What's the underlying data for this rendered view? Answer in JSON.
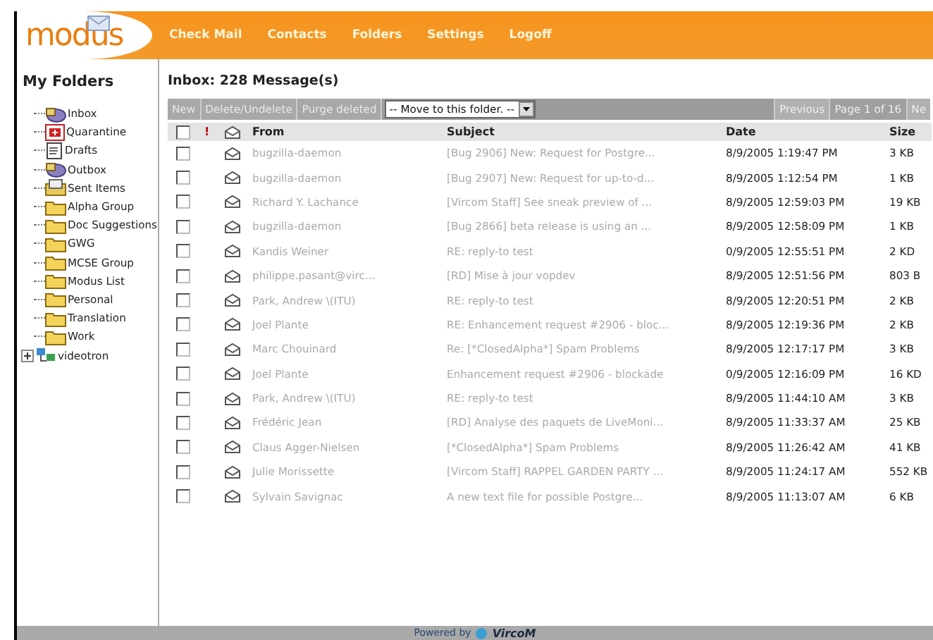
{
  "header": {
    "logo": "modus",
    "nav": [
      "Check Mail",
      "Contacts",
      "Folders",
      "Settings",
      "Logoff"
    ]
  },
  "sidebar": {
    "title": "My Folders",
    "items": [
      {
        "kind": "inbox",
        "label": "Inbox"
      },
      {
        "kind": "quarantine",
        "label": "Quarantine"
      },
      {
        "kind": "drafts",
        "label": "Drafts"
      },
      {
        "kind": "outbox",
        "label": "Outbox"
      },
      {
        "kind": "sent",
        "label": "Sent Items"
      },
      {
        "kind": "folder",
        "label": "Alpha Group"
      },
      {
        "kind": "folder",
        "label": "Doc Suggestions"
      },
      {
        "kind": "folder",
        "label": "GWG"
      },
      {
        "kind": "folder",
        "label": "MCSE Group"
      },
      {
        "kind": "folder",
        "label": "Modus List"
      },
      {
        "kind": "folder",
        "label": "Personal"
      },
      {
        "kind": "folder",
        "label": "Translation"
      },
      {
        "kind": "folder",
        "label": "Work"
      },
      {
        "kind": "account",
        "label": "videotron",
        "expanded": false
      }
    ]
  },
  "mailbox": {
    "title": "Inbox: 228 Message(s)",
    "toolbar": {
      "buttons": [
        "New",
        "Delete/Undelete",
        "Purge deleted"
      ],
      "move_select": "-- Move to this folder. --",
      "pager": [
        "Previous",
        "Page 1 of 16",
        "Ne"
      ]
    },
    "columns": {
      "select_all": false,
      "priority": "!",
      "from": "From",
      "subject": "Subject",
      "date": "Date",
      "size": "Size"
    },
    "rows": [
      {
        "from": "bugzilla-daemon",
        "subject": "[Bug 2906] New: Request for Postgre...",
        "date": "8/9/2005 1:19:47 PM",
        "size": "3 KB",
        "checked": false
      },
      {
        "from": "bugzilla-daemon",
        "subject": "[Bug 2907] New: Request for up-to-d...",
        "date": "8/9/2005 1:12:54 PM",
        "size": "1 KB",
        "checked": false
      },
      {
        "from": "Richard Y. Lachance",
        "subject": "[Vircom Staff] See sneak preview of ...",
        "date": "8/9/2005 12:59:03 PM",
        "size": "19 KB",
        "checked": false
      },
      {
        "from": "bugzilla-daemon",
        "subject": "[Bug 2866] beta release is using an ...",
        "date": "8/9/2005 12:58:09 PM",
        "size": "1 KB",
        "checked": false
      },
      {
        "from": "Kandis Weiner",
        "subject": "RE: reply-to test",
        "date": "0/9/2005 12:55:51 PM",
        "size": "2 KD",
        "checked": false
      },
      {
        "from": "philippe.pasant@virc...",
        "subject": "[RD] Mise à jour vopdev",
        "date": "8/9/2005 12:51:56 PM",
        "size": "803 B",
        "checked": false
      },
      {
        "from": "Park, Andrew \\(ITU)",
        "subject": "RE: reply-to test",
        "date": "8/9/2005 12:20:51 PM",
        "size": "2 KB",
        "checked": false
      },
      {
        "from": "Joel Plante",
        "subject": "RE: Enhancement request #2906 - bloc...",
        "date": "8/9/2005 12:19:36 PM",
        "size": "2 KB",
        "checked": false
      },
      {
        "from": "Marc Chouinard",
        "subject": "Re: [*ClosedAlpha*] Spam Problems",
        "date": "8/9/2005 12:17:17 PM",
        "size": "3 KB",
        "checked": false
      },
      {
        "from": "Joel Plante",
        "subject": "Enhancement request #2906 - blockade",
        "date": "0/9/2005 12:16:09 PM",
        "size": "16 KD",
        "checked": false
      },
      {
        "from": "Park, Andrew \\(ITU)",
        "subject": "RE: reply-to test",
        "date": "8/9/2005 11:44:10 AM",
        "size": "3 KB",
        "checked": false
      },
      {
        "from": "Frédéric Jean",
        "subject": "[RD] Analyse des paquets de LiveMoni...",
        "date": "8/9/2005 11:33:37 AM",
        "size": "25 KB",
        "checked": false
      },
      {
        "from": "Claus Agger-Nielsen",
        "subject": "[*ClosedAlpha*] Spam Problems",
        "date": "8/9/2005 11:26:42 AM",
        "size": "41 KB",
        "checked": false
      },
      {
        "from": "Julie Morissette",
        "subject": "[Vircom Staff] RAPPEL GARDEN PARTY ...",
        "date": "8/9/2005 11:24:17 AM",
        "size": "552 KB",
        "checked": false
      },
      {
        "from": "Sylvain Savignac",
        "subject": "A new text file for possible Postgre...",
        "date": "8/9/2005 11:13:07 AM",
        "size": "6 KB",
        "checked": false
      }
    ]
  },
  "footer": {
    "powered_by": "Powered by",
    "brand": "VircoM"
  }
}
